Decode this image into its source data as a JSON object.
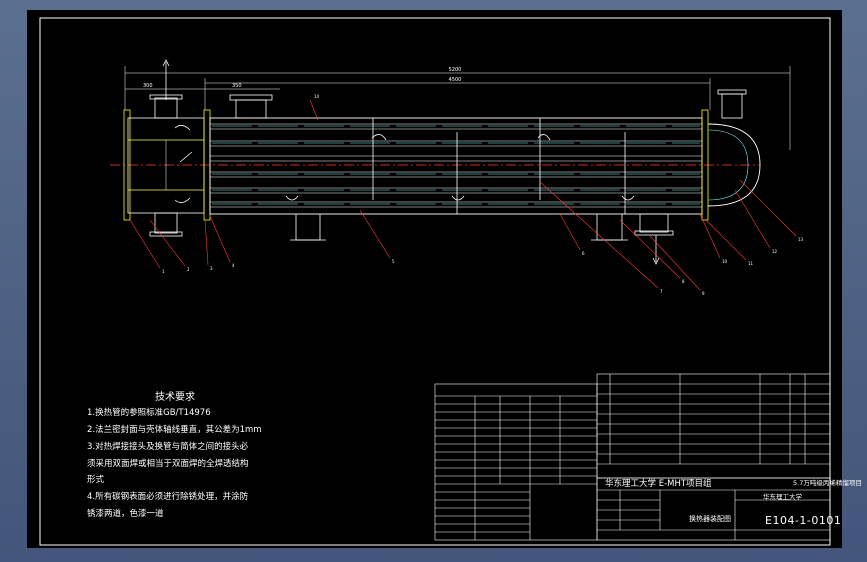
{
  "drawing": {
    "technical_requirements": {
      "title": "技术要求",
      "items": [
        "1.换热管的参照标准GB/T14976",
        "2.法兰密封面与壳体轴线垂直，其公差为1mm",
        "3.对热焊接接头及换管与简体之间的接头必",
        "须采用双面焊或相当于双面焊的全焊透结构",
        "形式",
        "4.所有碳钢表面必须进行除锈处理，并涂防",
        "锈漆两道，色漆一道"
      ]
    },
    "title_block": {
      "organization": "华东理工大学 E-MHT项目组",
      "project": "5.7万吨级丙烯精馏项目",
      "drawing_number": "E104-1-0101",
      "drawing_name": "换热器装配图",
      "company": "华东理工大学"
    },
    "dimensions": {
      "overall": "5200",
      "tube_length": "4500",
      "left_spacing_a": "300",
      "left_spacing_b": "350"
    },
    "callouts": [
      "1",
      "2",
      "3",
      "4",
      "5",
      "6",
      "7",
      "8",
      "9",
      "10",
      "11",
      "12",
      "13",
      "14"
    ],
    "colors": {
      "background": "#000000",
      "line": "#ffffff",
      "center": "#ff3b3b",
      "nozzle": "#ffff4d",
      "tubesheet": "#ffff00",
      "highlight": "#66ffff",
      "frame_outer": "#5b6f8f"
    }
  }
}
